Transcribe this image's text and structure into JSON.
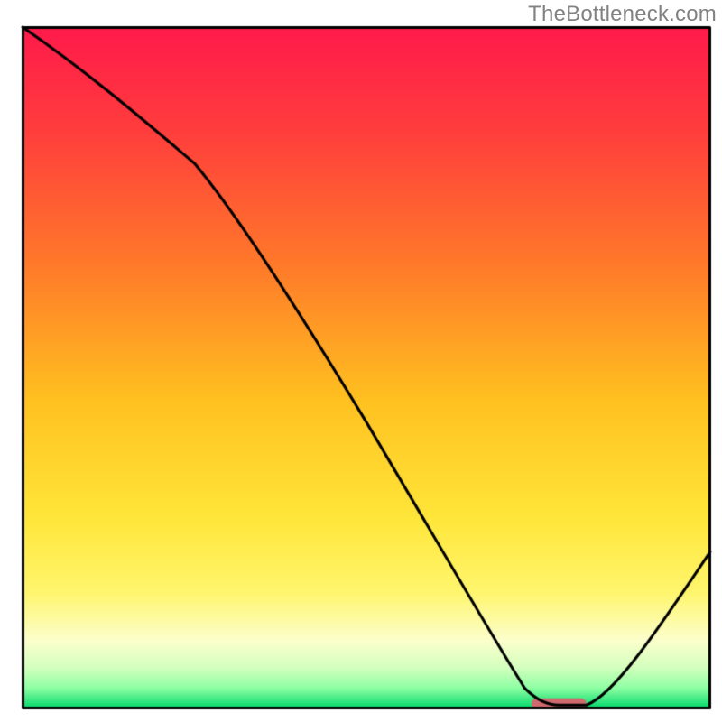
{
  "watermark": "TheBottleneck.com",
  "chart_data": {
    "type": "line",
    "title": "",
    "xlabel": "",
    "ylabel": "",
    "xlim": [
      0,
      100
    ],
    "ylim": [
      0,
      100
    ],
    "x": [
      0,
      25,
      73,
      78,
      82,
      100
    ],
    "y": [
      100,
      80,
      3,
      0.5,
      0.5,
      23
    ],
    "marker": {
      "x0": 74,
      "x1": 82,
      "y": 0.7
    },
    "gradient_stops": [
      {
        "pos": 0.0,
        "color": "#ff1a4b"
      },
      {
        "pos": 0.15,
        "color": "#ff3d3d"
      },
      {
        "pos": 0.35,
        "color": "#ff7a2a"
      },
      {
        "pos": 0.55,
        "color": "#ffc220"
      },
      {
        "pos": 0.72,
        "color": "#ffe63a"
      },
      {
        "pos": 0.83,
        "color": "#fff66e"
      },
      {
        "pos": 0.9,
        "color": "#fcffcc"
      },
      {
        "pos": 0.94,
        "color": "#d4ffbe"
      },
      {
        "pos": 0.97,
        "color": "#8effa3"
      },
      {
        "pos": 1.0,
        "color": "#00d86b"
      }
    ],
    "marker_color": "#d16a6f",
    "curve_color": "#000000",
    "border_color": "#000000"
  }
}
